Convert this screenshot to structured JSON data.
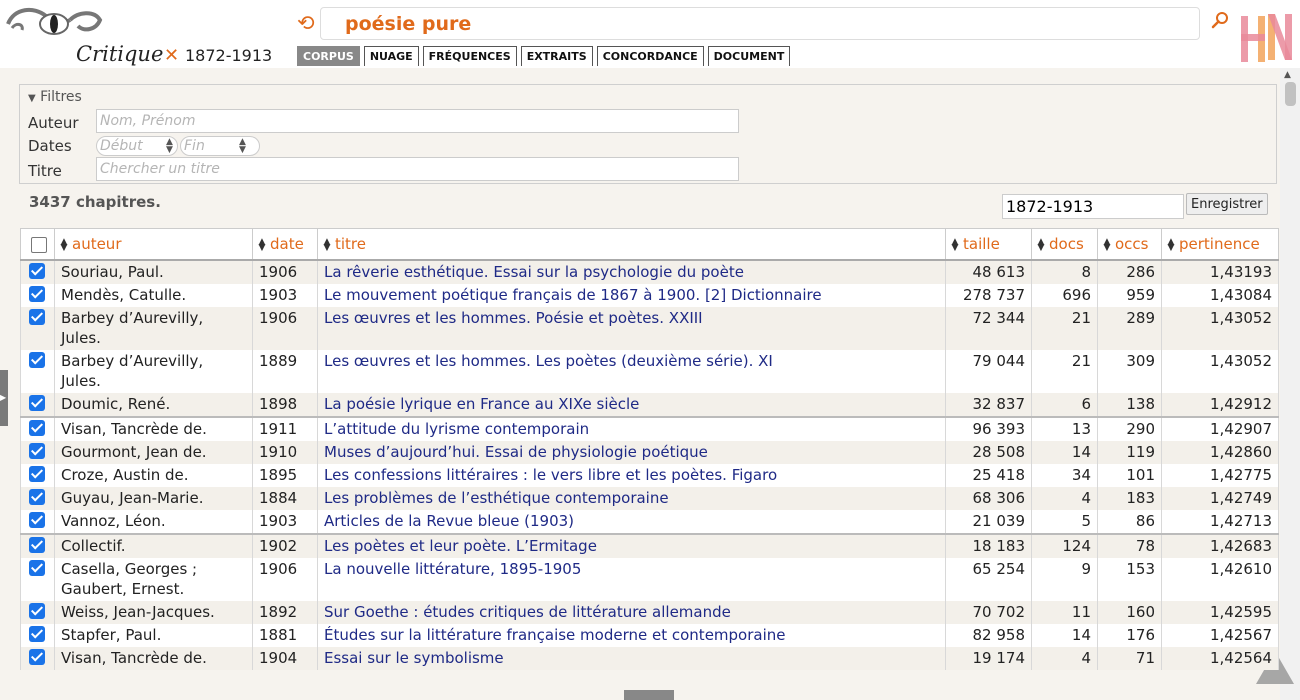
{
  "header": {
    "brand": "Critique",
    "corpus_name": "1872-1913",
    "query": "poésie pure",
    "tabs": [
      {
        "label": "CORPUS",
        "active": true
      },
      {
        "label": "NUAGE",
        "active": false
      },
      {
        "label": "FRÉQUENCES",
        "active": false
      },
      {
        "label": "EXTRAITS",
        "active": false
      },
      {
        "label": "CONCORDANCE",
        "active": false
      },
      {
        "label": "DOCUMENT",
        "active": false
      }
    ]
  },
  "filters": {
    "legend": "Filtres",
    "auteur_label": "Auteur",
    "auteur_placeholder": "Nom, Prénom",
    "dates_label": "Dates",
    "debut_placeholder": "Début",
    "fin_placeholder": "Fin",
    "titre_label": "Titre",
    "titre_placeholder": "Chercher un titre"
  },
  "summary": {
    "count_text": "3437 chapitres.",
    "save_value": "1872-1913",
    "save_label": "Enregistrer"
  },
  "table": {
    "columns": {
      "auteur": "auteur",
      "date": "date",
      "titre": "titre",
      "taille": "taille",
      "docs": "docs",
      "occs": "occs",
      "pertinence": "pertinence"
    },
    "rows": [
      {
        "checked": true,
        "auteur": "Souriau, Paul.",
        "date": "1906",
        "titre": "La rêverie esthétique. Essai sur la psychologie du poète",
        "taille": "48 613",
        "docs": "8",
        "occs": "286",
        "pertinence": "1,43193"
      },
      {
        "checked": true,
        "auteur": "Mendès, Catulle.",
        "date": "1903",
        "titre": "Le mouvement poétique français de 1867 à 1900. [2] Dictionnaire",
        "taille": "278 737",
        "docs": "696",
        "occs": "959",
        "pertinence": "1,43084"
      },
      {
        "checked": true,
        "auteur": "Barbey d’Aurevilly, Jules.",
        "date": "1906",
        "titre": "Les œuvres et les hommes. Poésie et poètes. XXIII",
        "taille": "72 344",
        "docs": "21",
        "occs": "289",
        "pertinence": "1,43052"
      },
      {
        "checked": true,
        "auteur": "Barbey d’Aurevilly, Jules.",
        "date": "1889",
        "titre": "Les œuvres et les hommes. Les poètes (deuxième série). XI",
        "taille": "79 044",
        "docs": "21",
        "occs": "309",
        "pertinence": "1,43052"
      },
      {
        "checked": true,
        "auteur": "Doumic, René.",
        "date": "1898",
        "titre": "La poésie lyrique en France au XIXe siècle",
        "taille": "32 837",
        "docs": "6",
        "occs": "138",
        "pertinence": "1,42912"
      },
      {
        "checked": true,
        "auteur": "Visan, Tancrède de.",
        "date": "1911",
        "titre": "L’attitude du lyrisme contemporain",
        "taille": "96 393",
        "docs": "13",
        "occs": "290",
        "pertinence": "1,42907"
      },
      {
        "checked": true,
        "auteur": "Gourmont, Jean de.",
        "date": "1910",
        "titre": "Muses d’aujourd’hui. Essai de physiologie poétique",
        "taille": "28 508",
        "docs": "14",
        "occs": "119",
        "pertinence": "1,42860"
      },
      {
        "checked": true,
        "auteur": "Croze, Austin de.",
        "date": "1895",
        "titre": "Les confessions littéraires : le vers libre et les poètes. Figaro",
        "taille": "25 418",
        "docs": "34",
        "occs": "101",
        "pertinence": "1,42775"
      },
      {
        "checked": true,
        "auteur": "Guyau, Jean-Marie.",
        "date": "1884",
        "titre": "Les problèmes de l’esthétique contemporaine",
        "taille": "68 306",
        "docs": "4",
        "occs": "183",
        "pertinence": "1,42749"
      },
      {
        "checked": true,
        "auteur": "Vannoz, Léon.",
        "date": "1903",
        "titre": "Articles de la Revue bleue (1903)",
        "taille": "21 039",
        "docs": "5",
        "occs": "86",
        "pertinence": "1,42713"
      },
      {
        "checked": true,
        "auteur": "Collectif.",
        "date": "1902",
        "titre": "Les poètes et leur poète. L’Ermitage",
        "taille": "18 183",
        "docs": "124",
        "occs": "78",
        "pertinence": "1,42683"
      },
      {
        "checked": true,
        "auteur": "Casella, Georges ; Gaubert, Ernest.",
        "date": "1906",
        "titre": "La nouvelle littérature, 1895-1905",
        "taille": "65 254",
        "docs": "9",
        "occs": "153",
        "pertinence": "1,42610"
      },
      {
        "checked": true,
        "auteur": "Weiss, Jean-Jacques.",
        "date": "1892",
        "titre": "Sur Goethe : études critiques de littérature allemande",
        "taille": "70 702",
        "docs": "11",
        "occs": "160",
        "pertinence": "1,42595"
      },
      {
        "checked": true,
        "auteur": "Stapfer, Paul.",
        "date": "1881",
        "titre": "Études sur la littérature française moderne et contemporaine",
        "taille": "82 958",
        "docs": "14",
        "occs": "176",
        "pertinence": "1,42567"
      },
      {
        "checked": true,
        "auteur": "Visan, Tancrède de.",
        "date": "1904",
        "titre": "Essai sur le symbolisme",
        "taille": "19 174",
        "docs": "4",
        "occs": "71",
        "pertinence": "1,42564"
      }
    ]
  },
  "colors": {
    "accent": "#e06a1b",
    "link": "#1f2a86",
    "checkbox": "#1a73e8",
    "active_tab": "#888888"
  }
}
